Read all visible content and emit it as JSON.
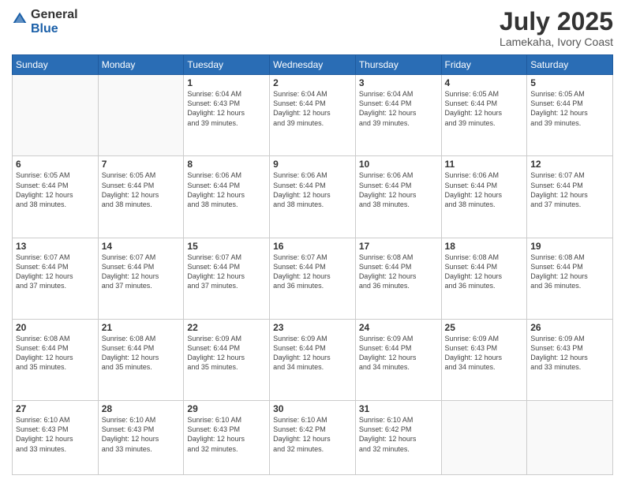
{
  "logo": {
    "general": "General",
    "blue": "Blue"
  },
  "header": {
    "month_year": "July 2025",
    "location": "Lamekaha, Ivory Coast"
  },
  "days_of_week": [
    "Sunday",
    "Monday",
    "Tuesday",
    "Wednesday",
    "Thursday",
    "Friday",
    "Saturday"
  ],
  "weeks": [
    [
      {
        "day": "",
        "info": ""
      },
      {
        "day": "",
        "info": ""
      },
      {
        "day": "1",
        "info": "Sunrise: 6:04 AM\nSunset: 6:43 PM\nDaylight: 12 hours\nand 39 minutes."
      },
      {
        "day": "2",
        "info": "Sunrise: 6:04 AM\nSunset: 6:44 PM\nDaylight: 12 hours\nand 39 minutes."
      },
      {
        "day": "3",
        "info": "Sunrise: 6:04 AM\nSunset: 6:44 PM\nDaylight: 12 hours\nand 39 minutes."
      },
      {
        "day": "4",
        "info": "Sunrise: 6:05 AM\nSunset: 6:44 PM\nDaylight: 12 hours\nand 39 minutes."
      },
      {
        "day": "5",
        "info": "Sunrise: 6:05 AM\nSunset: 6:44 PM\nDaylight: 12 hours\nand 39 minutes."
      }
    ],
    [
      {
        "day": "6",
        "info": "Sunrise: 6:05 AM\nSunset: 6:44 PM\nDaylight: 12 hours\nand 38 minutes."
      },
      {
        "day": "7",
        "info": "Sunrise: 6:05 AM\nSunset: 6:44 PM\nDaylight: 12 hours\nand 38 minutes."
      },
      {
        "day": "8",
        "info": "Sunrise: 6:06 AM\nSunset: 6:44 PM\nDaylight: 12 hours\nand 38 minutes."
      },
      {
        "day": "9",
        "info": "Sunrise: 6:06 AM\nSunset: 6:44 PM\nDaylight: 12 hours\nand 38 minutes."
      },
      {
        "day": "10",
        "info": "Sunrise: 6:06 AM\nSunset: 6:44 PM\nDaylight: 12 hours\nand 38 minutes."
      },
      {
        "day": "11",
        "info": "Sunrise: 6:06 AM\nSunset: 6:44 PM\nDaylight: 12 hours\nand 38 minutes."
      },
      {
        "day": "12",
        "info": "Sunrise: 6:07 AM\nSunset: 6:44 PM\nDaylight: 12 hours\nand 37 minutes."
      }
    ],
    [
      {
        "day": "13",
        "info": "Sunrise: 6:07 AM\nSunset: 6:44 PM\nDaylight: 12 hours\nand 37 minutes."
      },
      {
        "day": "14",
        "info": "Sunrise: 6:07 AM\nSunset: 6:44 PM\nDaylight: 12 hours\nand 37 minutes."
      },
      {
        "day": "15",
        "info": "Sunrise: 6:07 AM\nSunset: 6:44 PM\nDaylight: 12 hours\nand 37 minutes."
      },
      {
        "day": "16",
        "info": "Sunrise: 6:07 AM\nSunset: 6:44 PM\nDaylight: 12 hours\nand 36 minutes."
      },
      {
        "day": "17",
        "info": "Sunrise: 6:08 AM\nSunset: 6:44 PM\nDaylight: 12 hours\nand 36 minutes."
      },
      {
        "day": "18",
        "info": "Sunrise: 6:08 AM\nSunset: 6:44 PM\nDaylight: 12 hours\nand 36 minutes."
      },
      {
        "day": "19",
        "info": "Sunrise: 6:08 AM\nSunset: 6:44 PM\nDaylight: 12 hours\nand 36 minutes."
      }
    ],
    [
      {
        "day": "20",
        "info": "Sunrise: 6:08 AM\nSunset: 6:44 PM\nDaylight: 12 hours\nand 35 minutes."
      },
      {
        "day": "21",
        "info": "Sunrise: 6:08 AM\nSunset: 6:44 PM\nDaylight: 12 hours\nand 35 minutes."
      },
      {
        "day": "22",
        "info": "Sunrise: 6:09 AM\nSunset: 6:44 PM\nDaylight: 12 hours\nand 35 minutes."
      },
      {
        "day": "23",
        "info": "Sunrise: 6:09 AM\nSunset: 6:44 PM\nDaylight: 12 hours\nand 34 minutes."
      },
      {
        "day": "24",
        "info": "Sunrise: 6:09 AM\nSunset: 6:44 PM\nDaylight: 12 hours\nand 34 minutes."
      },
      {
        "day": "25",
        "info": "Sunrise: 6:09 AM\nSunset: 6:43 PM\nDaylight: 12 hours\nand 34 minutes."
      },
      {
        "day": "26",
        "info": "Sunrise: 6:09 AM\nSunset: 6:43 PM\nDaylight: 12 hours\nand 33 minutes."
      }
    ],
    [
      {
        "day": "27",
        "info": "Sunrise: 6:10 AM\nSunset: 6:43 PM\nDaylight: 12 hours\nand 33 minutes."
      },
      {
        "day": "28",
        "info": "Sunrise: 6:10 AM\nSunset: 6:43 PM\nDaylight: 12 hours\nand 33 minutes."
      },
      {
        "day": "29",
        "info": "Sunrise: 6:10 AM\nSunset: 6:43 PM\nDaylight: 12 hours\nand 32 minutes."
      },
      {
        "day": "30",
        "info": "Sunrise: 6:10 AM\nSunset: 6:42 PM\nDaylight: 12 hours\nand 32 minutes."
      },
      {
        "day": "31",
        "info": "Sunrise: 6:10 AM\nSunset: 6:42 PM\nDaylight: 12 hours\nand 32 minutes."
      },
      {
        "day": "",
        "info": ""
      },
      {
        "day": "",
        "info": ""
      }
    ]
  ]
}
